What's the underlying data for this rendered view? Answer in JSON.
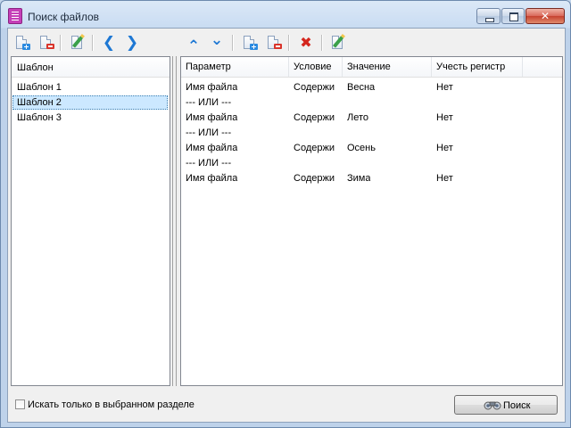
{
  "window": {
    "title": "Поиск файлов",
    "close_symbol": "✕"
  },
  "toolbar": {
    "left": [
      "add-template-icon",
      "delete-template-icon",
      "edit-template-icon",
      "arrow-left-icon",
      "arrow-right-icon"
    ],
    "right": [
      "move-up-icon",
      "move-down-icon",
      "add-condition-icon",
      "delete-condition-icon",
      "clear-icon",
      "edit-condition-icon"
    ],
    "glyphs": {
      "left": "❮",
      "right": "❯",
      "up": "⌃",
      "down": "⌄",
      "x": "✖"
    }
  },
  "templates": {
    "header": "Шаблон",
    "items": [
      "Шаблон 1",
      "Шаблон 2",
      "Шаблон 3"
    ],
    "selected_index": 1
  },
  "conditions": {
    "columns": [
      "Параметр",
      "Условие",
      "Значение",
      "Учесть регистр"
    ],
    "rows": [
      {
        "param": "Имя файла",
        "condition": "Содержи",
        "value": "Весна",
        "case": "Нет"
      },
      {
        "separator": "--- ИЛИ ---"
      },
      {
        "param": "Имя файла",
        "condition": "Содержи",
        "value": "Лето",
        "case": "Нет"
      },
      {
        "separator": "--- ИЛИ ---"
      },
      {
        "param": "Имя файла",
        "condition": "Содержи",
        "value": "Осень",
        "case": "Нет"
      },
      {
        "separator": "--- ИЛИ ---"
      },
      {
        "param": "Имя файла",
        "condition": "Содержи",
        "value": "Зима",
        "case": "Нет"
      }
    ]
  },
  "footer": {
    "checkbox_label": "Искать только в выбранном разделе",
    "checkbox_checked": false,
    "search_button": "Поиск"
  },
  "colors": {
    "selection": "#cce8ff",
    "icon_blue": "#1e78d4",
    "icon_red": "#d4261d"
  }
}
